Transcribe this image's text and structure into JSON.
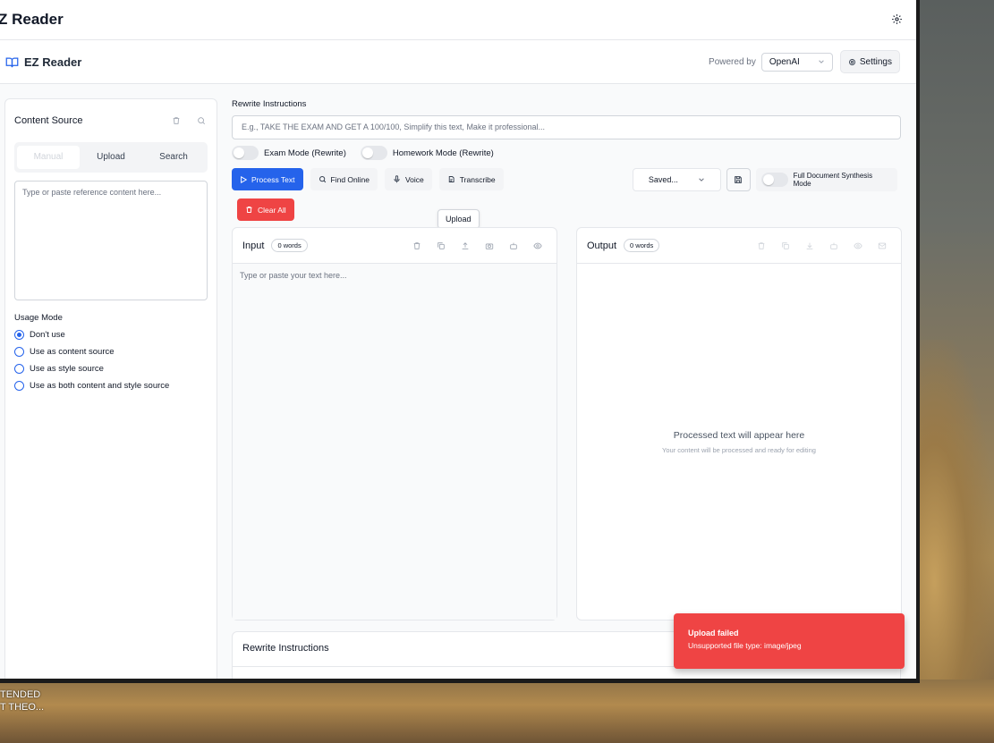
{
  "window": {
    "title": "Z Reader"
  },
  "app": {
    "brand": "EZ Reader",
    "powered_by_label": "Powered by",
    "provider": "OpenAI",
    "settings_label": "Settings"
  },
  "left": {
    "title": "Content Source",
    "tabs": [
      "Manual",
      "Upload",
      "Search"
    ],
    "reference_placeholder": "Type or paste reference content here...",
    "usage_label": "Usage Mode",
    "usage_options": [
      "Don't use",
      "Use as content source",
      "Use as style source",
      "Use as both content and style source"
    ],
    "usage_selected": "Don't use"
  },
  "center": {
    "rewrite_label": "Rewrite Instructions",
    "rewrite_placeholder": "E.g., TAKE THE EXAM AND GET A 100/100, Simplify this text, Make it professional...",
    "exam_mode": "Exam Mode (Rewrite)",
    "homework_mode": "Homework Mode (Rewrite)",
    "process_text": "Process Text",
    "find_online": "Find Online",
    "voice": "Voice",
    "transcribe": "Transcribe",
    "saved": "Saved...",
    "full_doc_mode": "Full Document Synthesis Mode",
    "clear_all": "Clear All",
    "tooltip": "Upload"
  },
  "input_panel": {
    "title": "Input",
    "word_count": "0 words",
    "placeholder": "Type or paste your text here..."
  },
  "output_panel": {
    "title": "Output",
    "word_count": "0 words",
    "placeholder_main": "Processed text will appear here",
    "placeholder_sub": "Your content will be processed and ready for editing"
  },
  "bottom_panel": {
    "title": "Rewrite Instructions"
  },
  "toast": {
    "title": "Upload failed",
    "message": "Unsupported file type: image/jpeg",
    "color": "#ef4444"
  },
  "desktop_text": [
    "TENDED",
    "T THEO..."
  ],
  "colors": {
    "accent": "#2563eb",
    "danger": "#ef4444"
  }
}
